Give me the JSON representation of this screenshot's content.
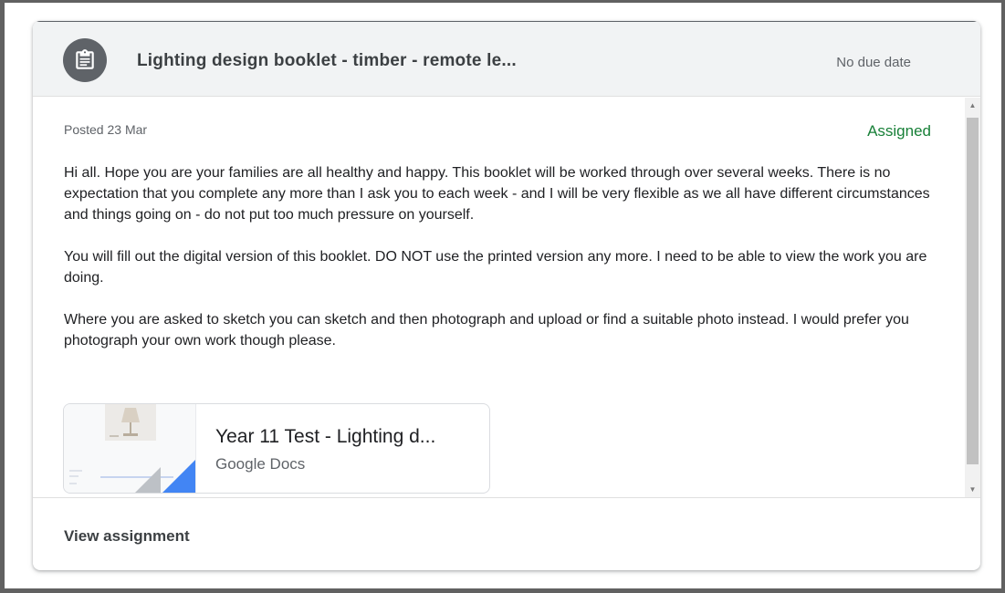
{
  "assignment": {
    "icon": "assignment-icon",
    "title": "Lighting design booklet - timber - remote le...",
    "due": "No due date",
    "posted": "Posted 23 Mar",
    "status": "Assigned",
    "paragraphs": [
      "Hi all. Hope you are your families are all healthy and happy. This booklet will be worked through over several weeks. There is no expectation that you complete any more than I ask you to each week - and I will be very flexible as we all have different circumstances and things going on - do not put too much pressure on yourself.",
      "You will fill out the digital version of this booklet. DO NOT use the printed version any more. I need to be able to view the work you are doing.",
      "Where you are asked to sketch you can sketch and then photograph and upload or find a suitable photo instead. I would prefer you photograph your own work though please."
    ],
    "attachment": {
      "title": "Year 11 Test - Lighting d...",
      "type": "Google Docs"
    },
    "view_label": "View assignment"
  },
  "colors": {
    "status": "#188038",
    "avatar": "#5f6368",
    "docs_blue": "#4285f4"
  }
}
